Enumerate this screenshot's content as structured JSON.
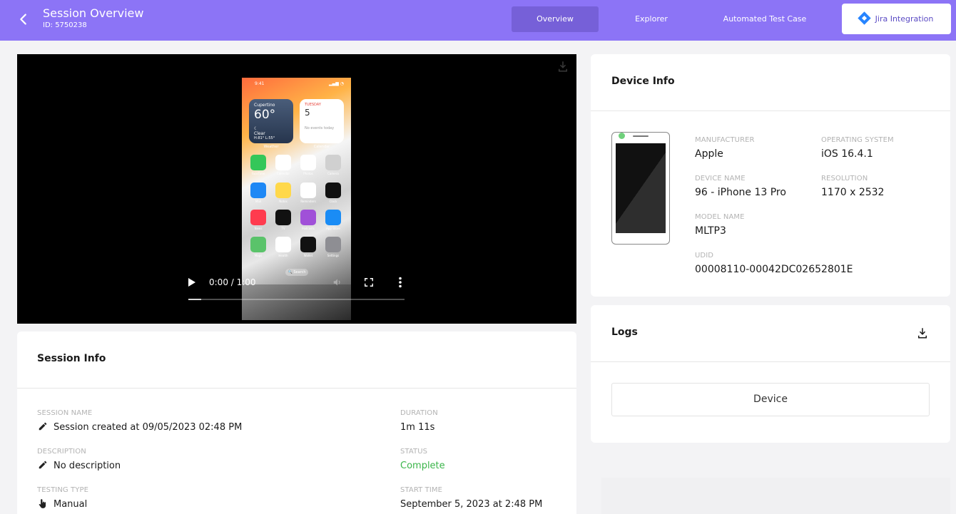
{
  "header": {
    "title": "Session Overview",
    "session_id": "ID: 5750238",
    "tabs": {
      "overview": "Overview",
      "explorer": "Explorer",
      "automated": "Automated Test Case",
      "jira": "Jira Integration"
    },
    "accent_color": "#8c74f6"
  },
  "video": {
    "time": "0:00 / 1:00",
    "progress_fraction": 0.06,
    "phone": {
      "status_time": "9:41",
      "weather": {
        "city": "Cupertino",
        "temp": "60°",
        "condition": "Clear",
        "range": "H:81° L:55°",
        "label": "Weather"
      },
      "calendar": {
        "day": "TUESDAY",
        "date": "5",
        "note": "No events today",
        "label": "Calendar"
      },
      "apps": [
        {
          "name": "FaceTime",
          "color": "#34c759"
        },
        {
          "name": "Calendar",
          "color": "#ffffff"
        },
        {
          "name": "Photos",
          "color": "#ffffff"
        },
        {
          "name": "Camera",
          "color": "#d0d0d0"
        },
        {
          "name": "Mail",
          "color": "#1e88f5"
        },
        {
          "name": "Notes",
          "color": "#ffd84a"
        },
        {
          "name": "Reminders",
          "color": "#ffffff"
        },
        {
          "name": "Clock",
          "color": "#111111"
        },
        {
          "name": "News",
          "color": "#ff3b4e"
        },
        {
          "name": "TV",
          "color": "#111111"
        },
        {
          "name": "Podcasts",
          "color": "#a050d8"
        },
        {
          "name": "App Store",
          "color": "#1a8cf5"
        },
        {
          "name": "Maps",
          "color": "#5ac36a"
        },
        {
          "name": "Health",
          "color": "#ffffff"
        },
        {
          "name": "Wallet",
          "color": "#111111"
        },
        {
          "name": "Settings",
          "color": "#8e8e93"
        }
      ],
      "search": "Search"
    }
  },
  "session_info": {
    "title": "Session Info",
    "session_name_label": "Session Name",
    "session_name": "Session created at 09/05/2023 02:48 PM",
    "description_label": "Description",
    "description": "No description",
    "testing_type_label": "Testing Type",
    "testing_type": "Manual",
    "duration_label": "Duration",
    "duration": "1m 11s",
    "status_label": "Status",
    "status": "Complete",
    "status_color": "#3bb54a",
    "start_time_label": "Start Time",
    "start_time": "September 5, 2023 at 2:48 PM"
  },
  "device_info": {
    "title": "Device Info",
    "manufacturer_label": "Manufacturer",
    "manufacturer": "Apple",
    "os_label": "Operating System",
    "os": "iOS 16.4.1",
    "device_name_label": "Device Name",
    "device_name": "96 - iPhone 13 Pro",
    "resolution_label": "Resolution",
    "resolution": "1170 x 2532",
    "model_label": "Model Name",
    "model": "MLTP3",
    "udid_label": "UDID",
    "udid": "00008110-00042DC02652801E"
  },
  "logs": {
    "title": "Logs",
    "device_button": "Device"
  }
}
